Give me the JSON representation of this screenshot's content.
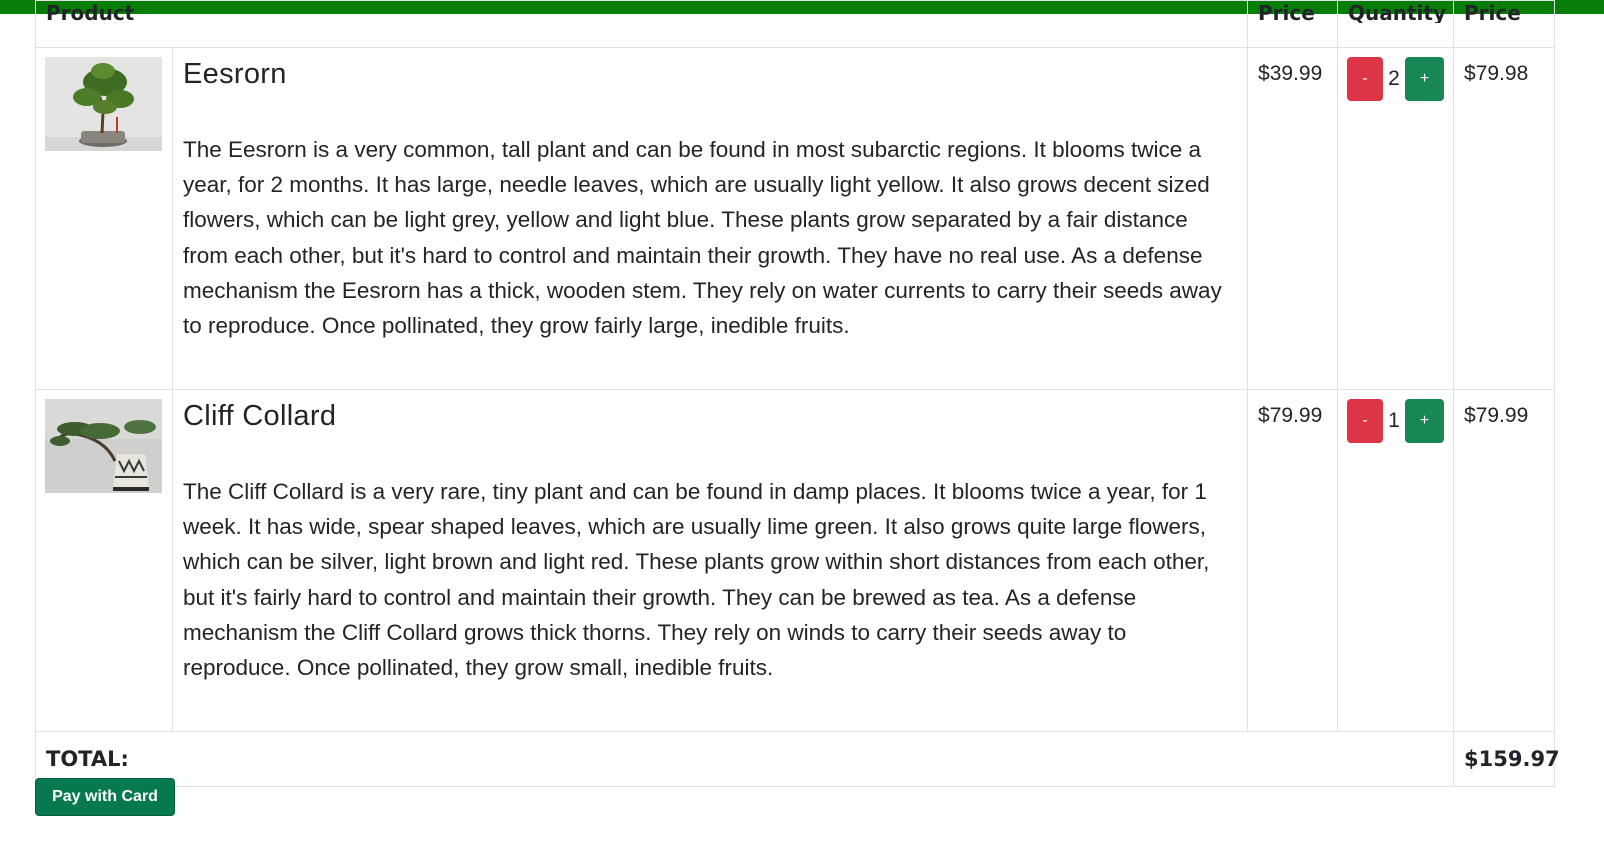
{
  "table": {
    "headers": {
      "product": "Product",
      "price": "Price",
      "quantity": "Quantity",
      "subtotal": "Price"
    },
    "items": [
      {
        "name": "Eesrorn",
        "description": "The Eesrorn is a very common, tall plant and can be found in most subarctic regions. It blooms twice a year, for 2 months. It has large, needle leaves, which are usually light yellow. It also grows decent sized flowers, which can be light grey, yellow and light blue. These plants grow separated by a fair distance from each other, but it's hard to control and maintain their growth. They have no real use. As a defense mechanism the Eesrorn has a thick, wooden stem. They rely on water currents to carry their seeds away to reproduce. Once pollinated, they grow fairly large, inedible fruits.",
        "price": "$39.99",
        "quantity": "2",
        "subtotal": "$79.98",
        "minus_label": "-",
        "plus_label": "+"
      },
      {
        "name": "Cliff Collard",
        "description": "The Cliff Collard is a very rare, tiny plant and can be found in damp places. It blooms twice a year, for 1 week. It has wide, spear shaped leaves, which are usually lime green. It also grows quite large flowers, which can be silver, light brown and light red. These plants grow within short distances from each other, but it's fairly hard to control and maintain their growth. They can be brewed as tea. As a defense mechanism the Cliff Collard grows thick thorns. They rely on winds to carry their seeds away to reproduce. Once pollinated, they grow small, inedible fruits.",
        "price": "$79.99",
        "quantity": "1",
        "subtotal": "$79.99",
        "minus_label": "-",
        "plus_label": "+"
      }
    ],
    "total_label": "TOTAL:",
    "total_value": "$159.97"
  },
  "pay_button": "Pay with Card",
  "colors": {
    "topbar": "#067d06",
    "minus": "#dc3545",
    "plus": "#198754",
    "pay": "#067a4e"
  }
}
